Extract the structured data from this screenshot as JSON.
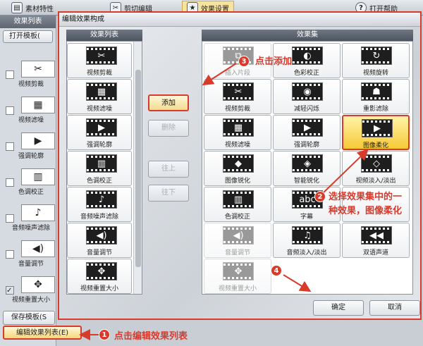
{
  "toolbar": {
    "items": [
      {
        "label": "素材特性",
        "icon": "material-icon"
      },
      {
        "label": "剪切编辑",
        "icon": "cut-icon"
      },
      {
        "label": "效果设置",
        "icon": "effect-icon"
      },
      {
        "label": "打开帮助",
        "icon": "help-icon"
      }
    ]
  },
  "left_panel": {
    "title": "效果列表",
    "open_template": "打开模板(",
    "items": [
      {
        "label": "视频剪裁",
        "icon": "scissors-icon",
        "checked": false
      },
      {
        "label": "视频滤噪",
        "icon": "noise-icon",
        "checked": false
      },
      {
        "label": "强调轮廓",
        "icon": "contour-icon",
        "checked": false
      },
      {
        "label": "色调校正",
        "icon": "color-bars-icon",
        "checked": false
      },
      {
        "label": "音频噪声滤除",
        "icon": "music-note-icon",
        "checked": false
      },
      {
        "label": "音量调节",
        "icon": "speaker-icon",
        "checked": false
      },
      {
        "label": "视频重置大小",
        "icon": "resize-icon",
        "checked": true
      }
    ],
    "save_template": "保存模板(S",
    "edit_effects": "编辑效果列表(E)"
  },
  "dialog": {
    "title": "编辑效果构成",
    "list_header": "效果列表",
    "set_header": "效果集",
    "effect_list": [
      {
        "label": "视频剪裁",
        "icon": "scissors-icon"
      },
      {
        "label": "视频滤噪",
        "icon": "noise-icon"
      },
      {
        "label": "强调轮廓",
        "icon": "contour-icon"
      },
      {
        "label": "色调校正",
        "icon": "color-bars-icon"
      },
      {
        "label": "音频噪声滤除",
        "icon": "music-note-icon"
      },
      {
        "label": "音量调节",
        "icon": "speaker-icon"
      },
      {
        "label": "视频重置大小",
        "icon": "resize-icon"
      }
    ],
    "buttons": {
      "add": "添加",
      "remove": "删除",
      "up": "往上",
      "down": "往下",
      "ok": "确定",
      "cancel": "取消"
    },
    "effect_set": [
      {
        "label": "插入片段",
        "icon": "insert-clip-icon",
        "state": "disabled"
      },
      {
        "label": "色彩校正",
        "icon": "color-correct-icon",
        "state": "normal"
      },
      {
        "label": "视频旋转",
        "icon": "rotate-icon",
        "state": "normal"
      },
      {
        "label": "视频剪裁",
        "icon": "scissors-icon",
        "state": "normal"
      },
      {
        "label": "减轻闪烁",
        "icon": "eye-icon",
        "state": "normal"
      },
      {
        "label": "重影滤除",
        "icon": "ghost-icon",
        "state": "normal"
      },
      {
        "label": "视频滤噪",
        "icon": "noise-icon",
        "state": "normal"
      },
      {
        "label": "强调轮廓",
        "icon": "contour-icon",
        "state": "normal"
      },
      {
        "label": "图像柔化",
        "icon": "soften-icon",
        "state": "selected"
      },
      {
        "label": "图像锐化",
        "icon": "sharpen-icon",
        "state": "normal"
      },
      {
        "label": "智能锐化",
        "icon": "smart-sharpen-icon",
        "state": "normal"
      },
      {
        "label": "视频淡入/淡出",
        "icon": "fade-icon",
        "state": "normal"
      },
      {
        "label": "色调校正",
        "icon": "color-bars-icon",
        "state": "normal"
      },
      {
        "label": "字幕",
        "icon": "subtitle-icon",
        "state": "normal"
      },
      {
        "label": "",
        "icon": "blank-tile",
        "state": "normal"
      },
      {
        "label": "音量调节",
        "icon": "speaker-icon",
        "state": "disabled"
      },
      {
        "label": "音频淡入/淡出",
        "icon": "audio-fade-icon",
        "state": "normal"
      },
      {
        "label": "双语声道",
        "icon": "bilingual-icon",
        "state": "normal"
      },
      {
        "label": "视频重置大小",
        "icon": "resize-icon",
        "state": "disabled"
      }
    ]
  },
  "annotations": {
    "step1": {
      "number": "1",
      "text": "点击编辑效果列表"
    },
    "step2": {
      "number": "2",
      "text_line1": "选择效果集中的一",
      "text_line2": "种效果，图像柔化"
    },
    "step3": {
      "number": "3",
      "text": "点击添加"
    },
    "step4": {
      "number": "4"
    }
  },
  "colors": {
    "annotation": "#d83a2c",
    "selected_tile": "#f7c934",
    "header": "#5d6671"
  }
}
